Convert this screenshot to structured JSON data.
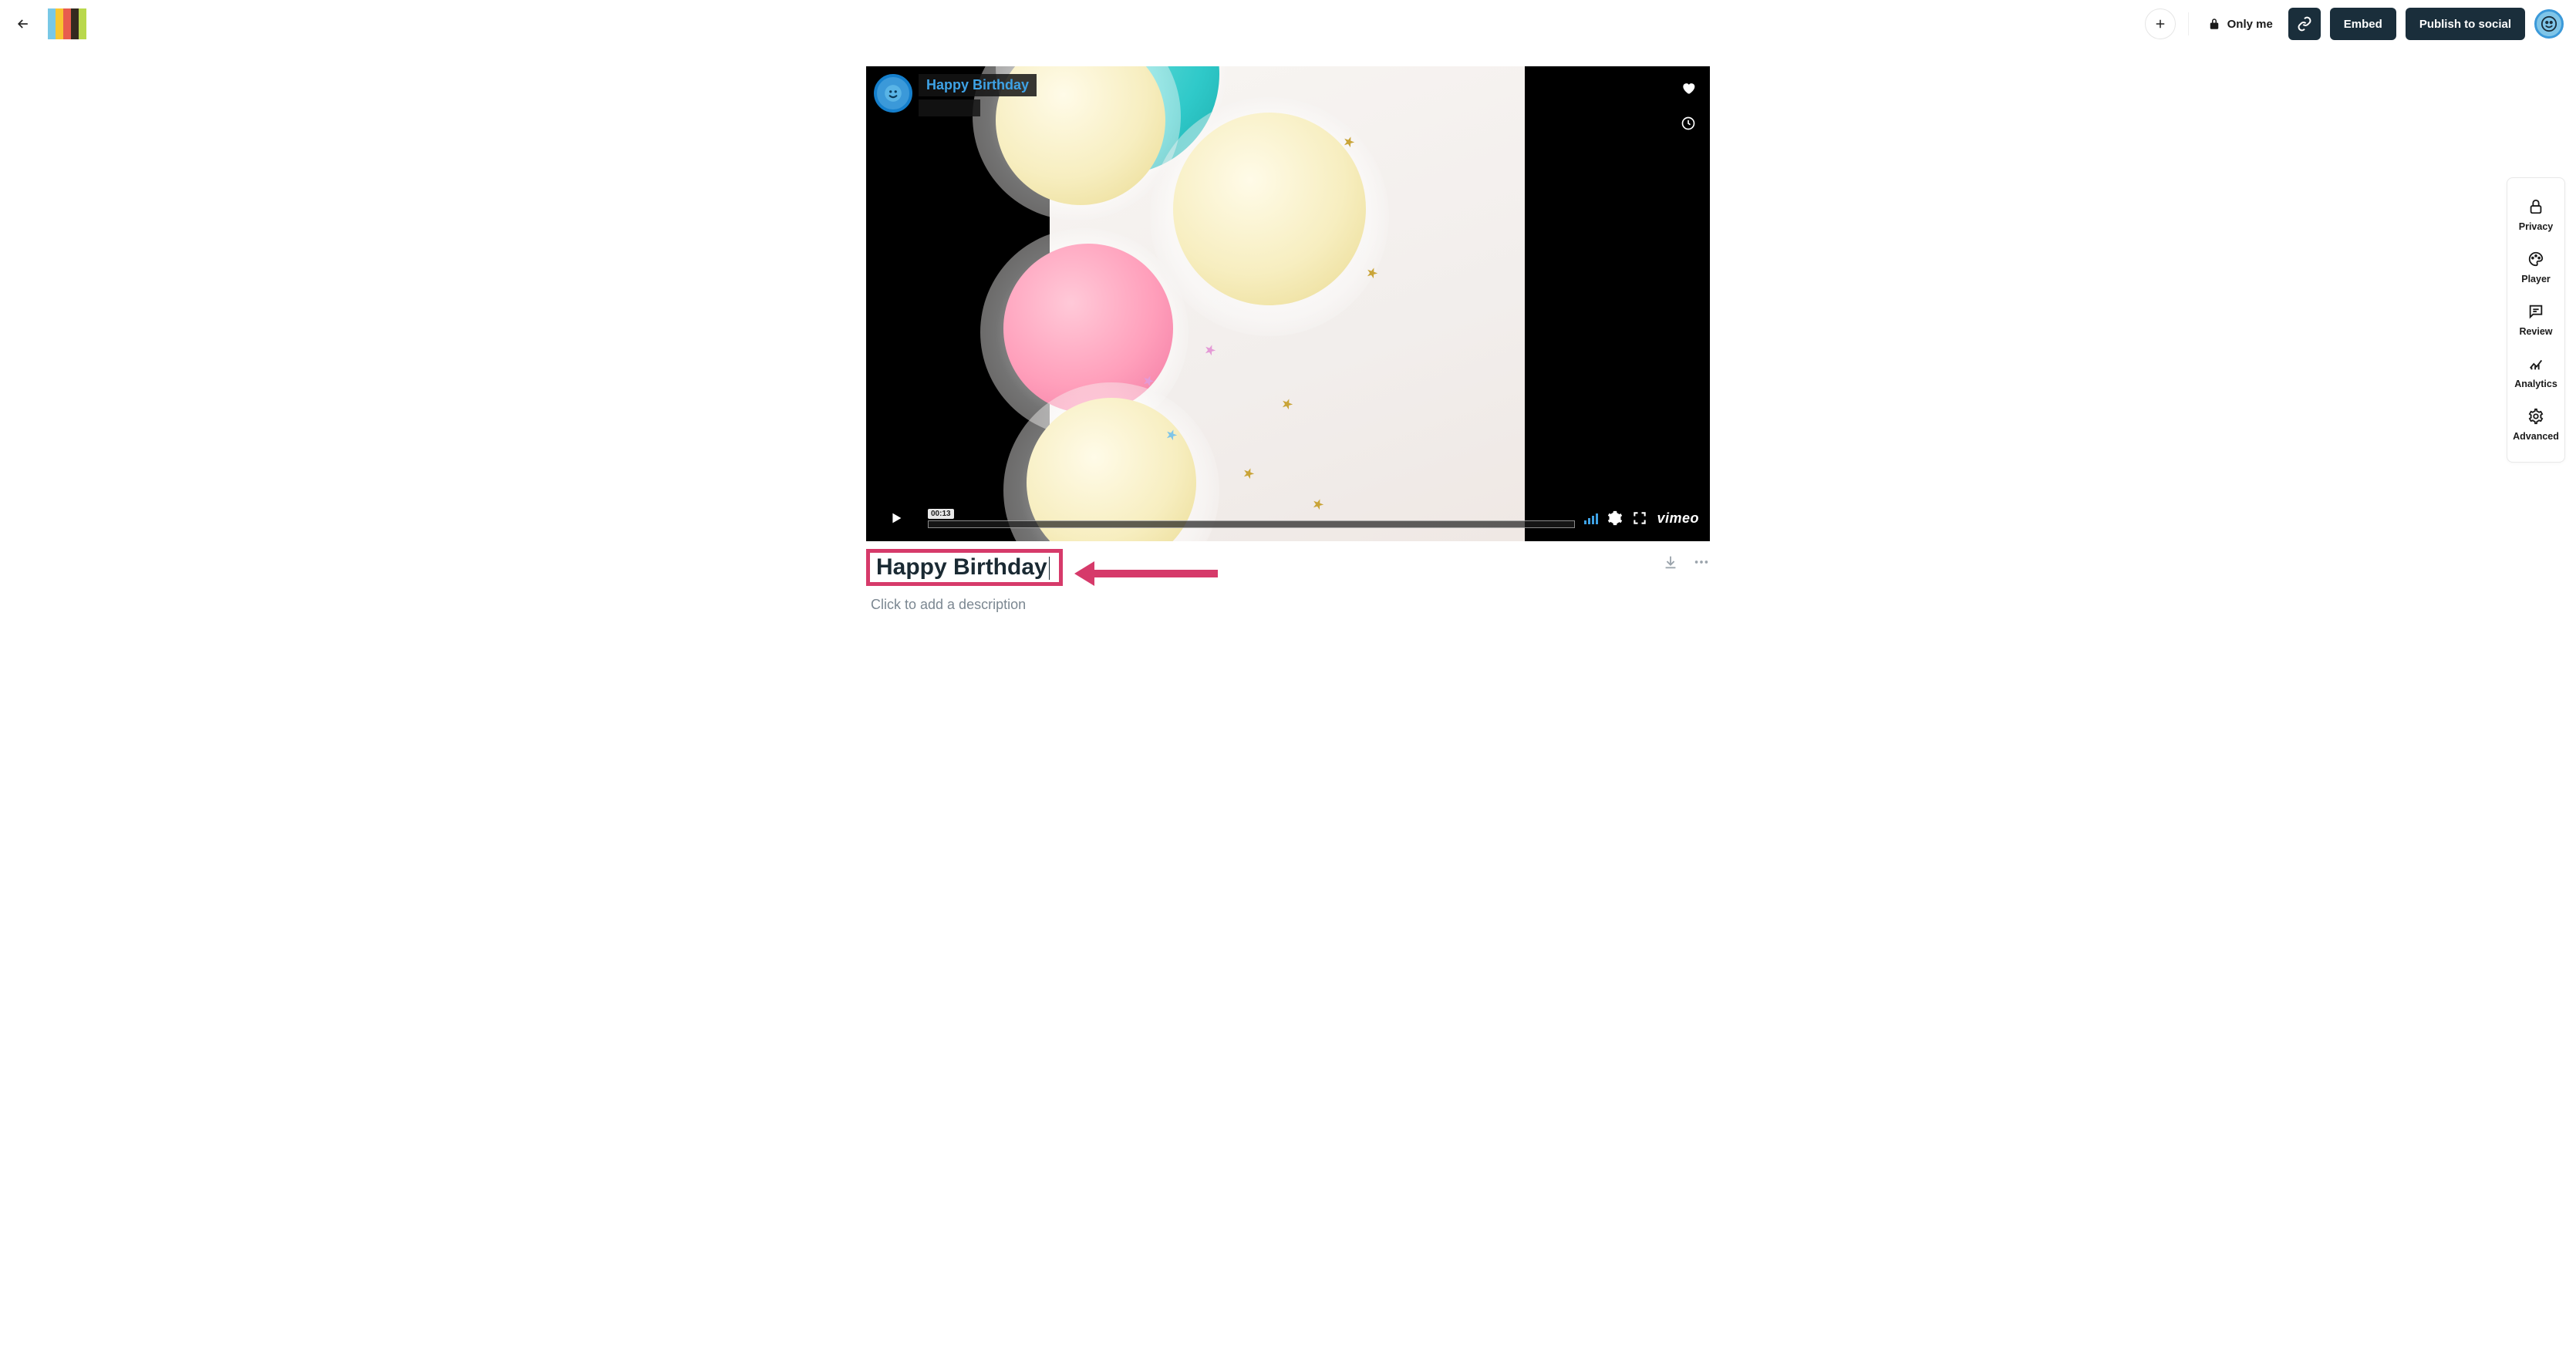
{
  "header": {
    "privacy_label": "Only me",
    "embed_label": "Embed",
    "publish_label": "Publish to social"
  },
  "player": {
    "overlay_title": "Happy Birthday",
    "timestamp": "00:13",
    "brand": "vimeo"
  },
  "title_editor": {
    "value": "Happy Birthday",
    "description_placeholder": "Click to add a description"
  },
  "rail": {
    "items": [
      {
        "label": "Privacy"
      },
      {
        "label": "Player"
      },
      {
        "label": "Review"
      },
      {
        "label": "Analytics"
      },
      {
        "label": "Advanced"
      }
    ]
  }
}
